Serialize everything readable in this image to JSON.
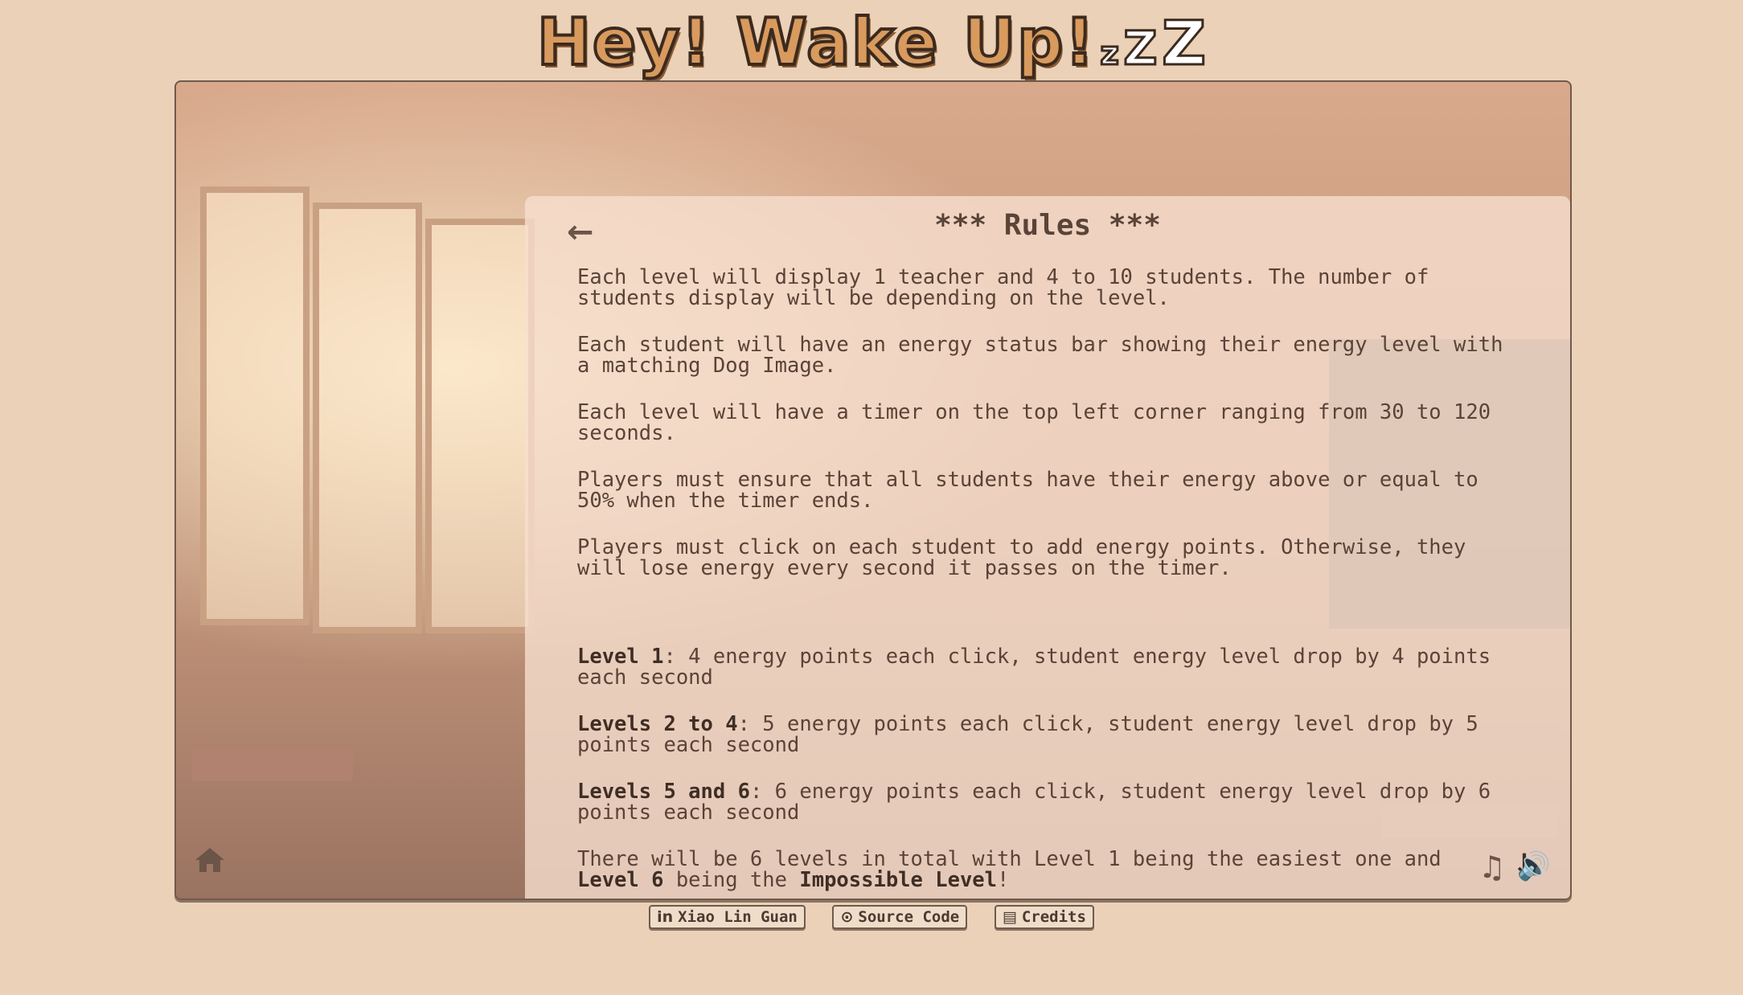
{
  "header": {
    "title": "Hey! Wake Up!",
    "z_small": "z",
    "z_mid": "Z",
    "z_large": "Z"
  },
  "panel": {
    "back_icon": "←",
    "title": "*** Rules ***",
    "rules": [
      "Each level will display 1 teacher and 4 to 10 students. The number of\nstudents display will be depending on the level.",
      "Each student will have an energy status bar showing their energy level with\na matching Dog Image.",
      "Each level will have a timer on the top left corner ranging from 30 to 120\nseconds.",
      "Players must ensure that all students have their energy above or equal to\n50% when the timer ends.",
      "Players must click on each student to add energy points. Otherwise, they\nwill lose energy every second it passes on the timer."
    ],
    "levels": [
      {
        "name": "Level 1",
        "text": ": 4 energy points each click, student energy level drop by 4 points\neach second"
      },
      {
        "name": "Levels 2 to 4",
        "text": ": 5 energy points each click, student energy level drop by 5\npoints each second"
      },
      {
        "name": "Levels 5 and 6",
        "text": ": 6 energy points each click, student energy level drop by 6\npoints each second"
      }
    ],
    "final": {
      "part1": "There will be 6 levels in total with Level 1 being the easiest one and\n",
      "bold1": "Level 6",
      "part2": " being the ",
      "bold2": "Impossible Level",
      "part3": "!"
    },
    "down_icon": "↓"
  },
  "controls": {
    "home_icon": "home-icon",
    "music_glyph": "♫",
    "sound_glyph": "🔊"
  },
  "footer": {
    "links": [
      {
        "icon": "in",
        "label": "Xiao Lin Guan"
      },
      {
        "icon": "⊙",
        "label": "Source Code"
      },
      {
        "icon": "▤",
        "label": "Credits"
      }
    ]
  }
}
